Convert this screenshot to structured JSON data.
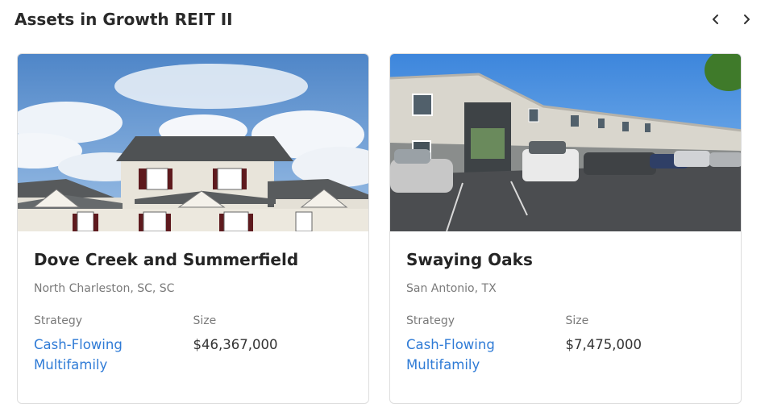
{
  "header": {
    "title": "Assets in Growth REIT II",
    "prev_icon": "chevron-left-icon",
    "next_icon": "chevron-right-icon"
  },
  "colors": {
    "link": "#2f7bd6",
    "muted": "#7a7a7a",
    "border": "#dedede"
  },
  "labels": {
    "strategy": "Strategy",
    "size": "Size"
  },
  "assets": [
    {
      "name": "Dove Creek and Summerfield",
      "location": "North Charleston, SC, SC",
      "strategy": "Cash-Flowing Multifamily",
      "size": "$46,367,000"
    },
    {
      "name": "Swaying Oaks",
      "location": "San Antonio, TX",
      "strategy": "Cash-Flowing Multifamily",
      "size": "$7,475,000"
    }
  ]
}
